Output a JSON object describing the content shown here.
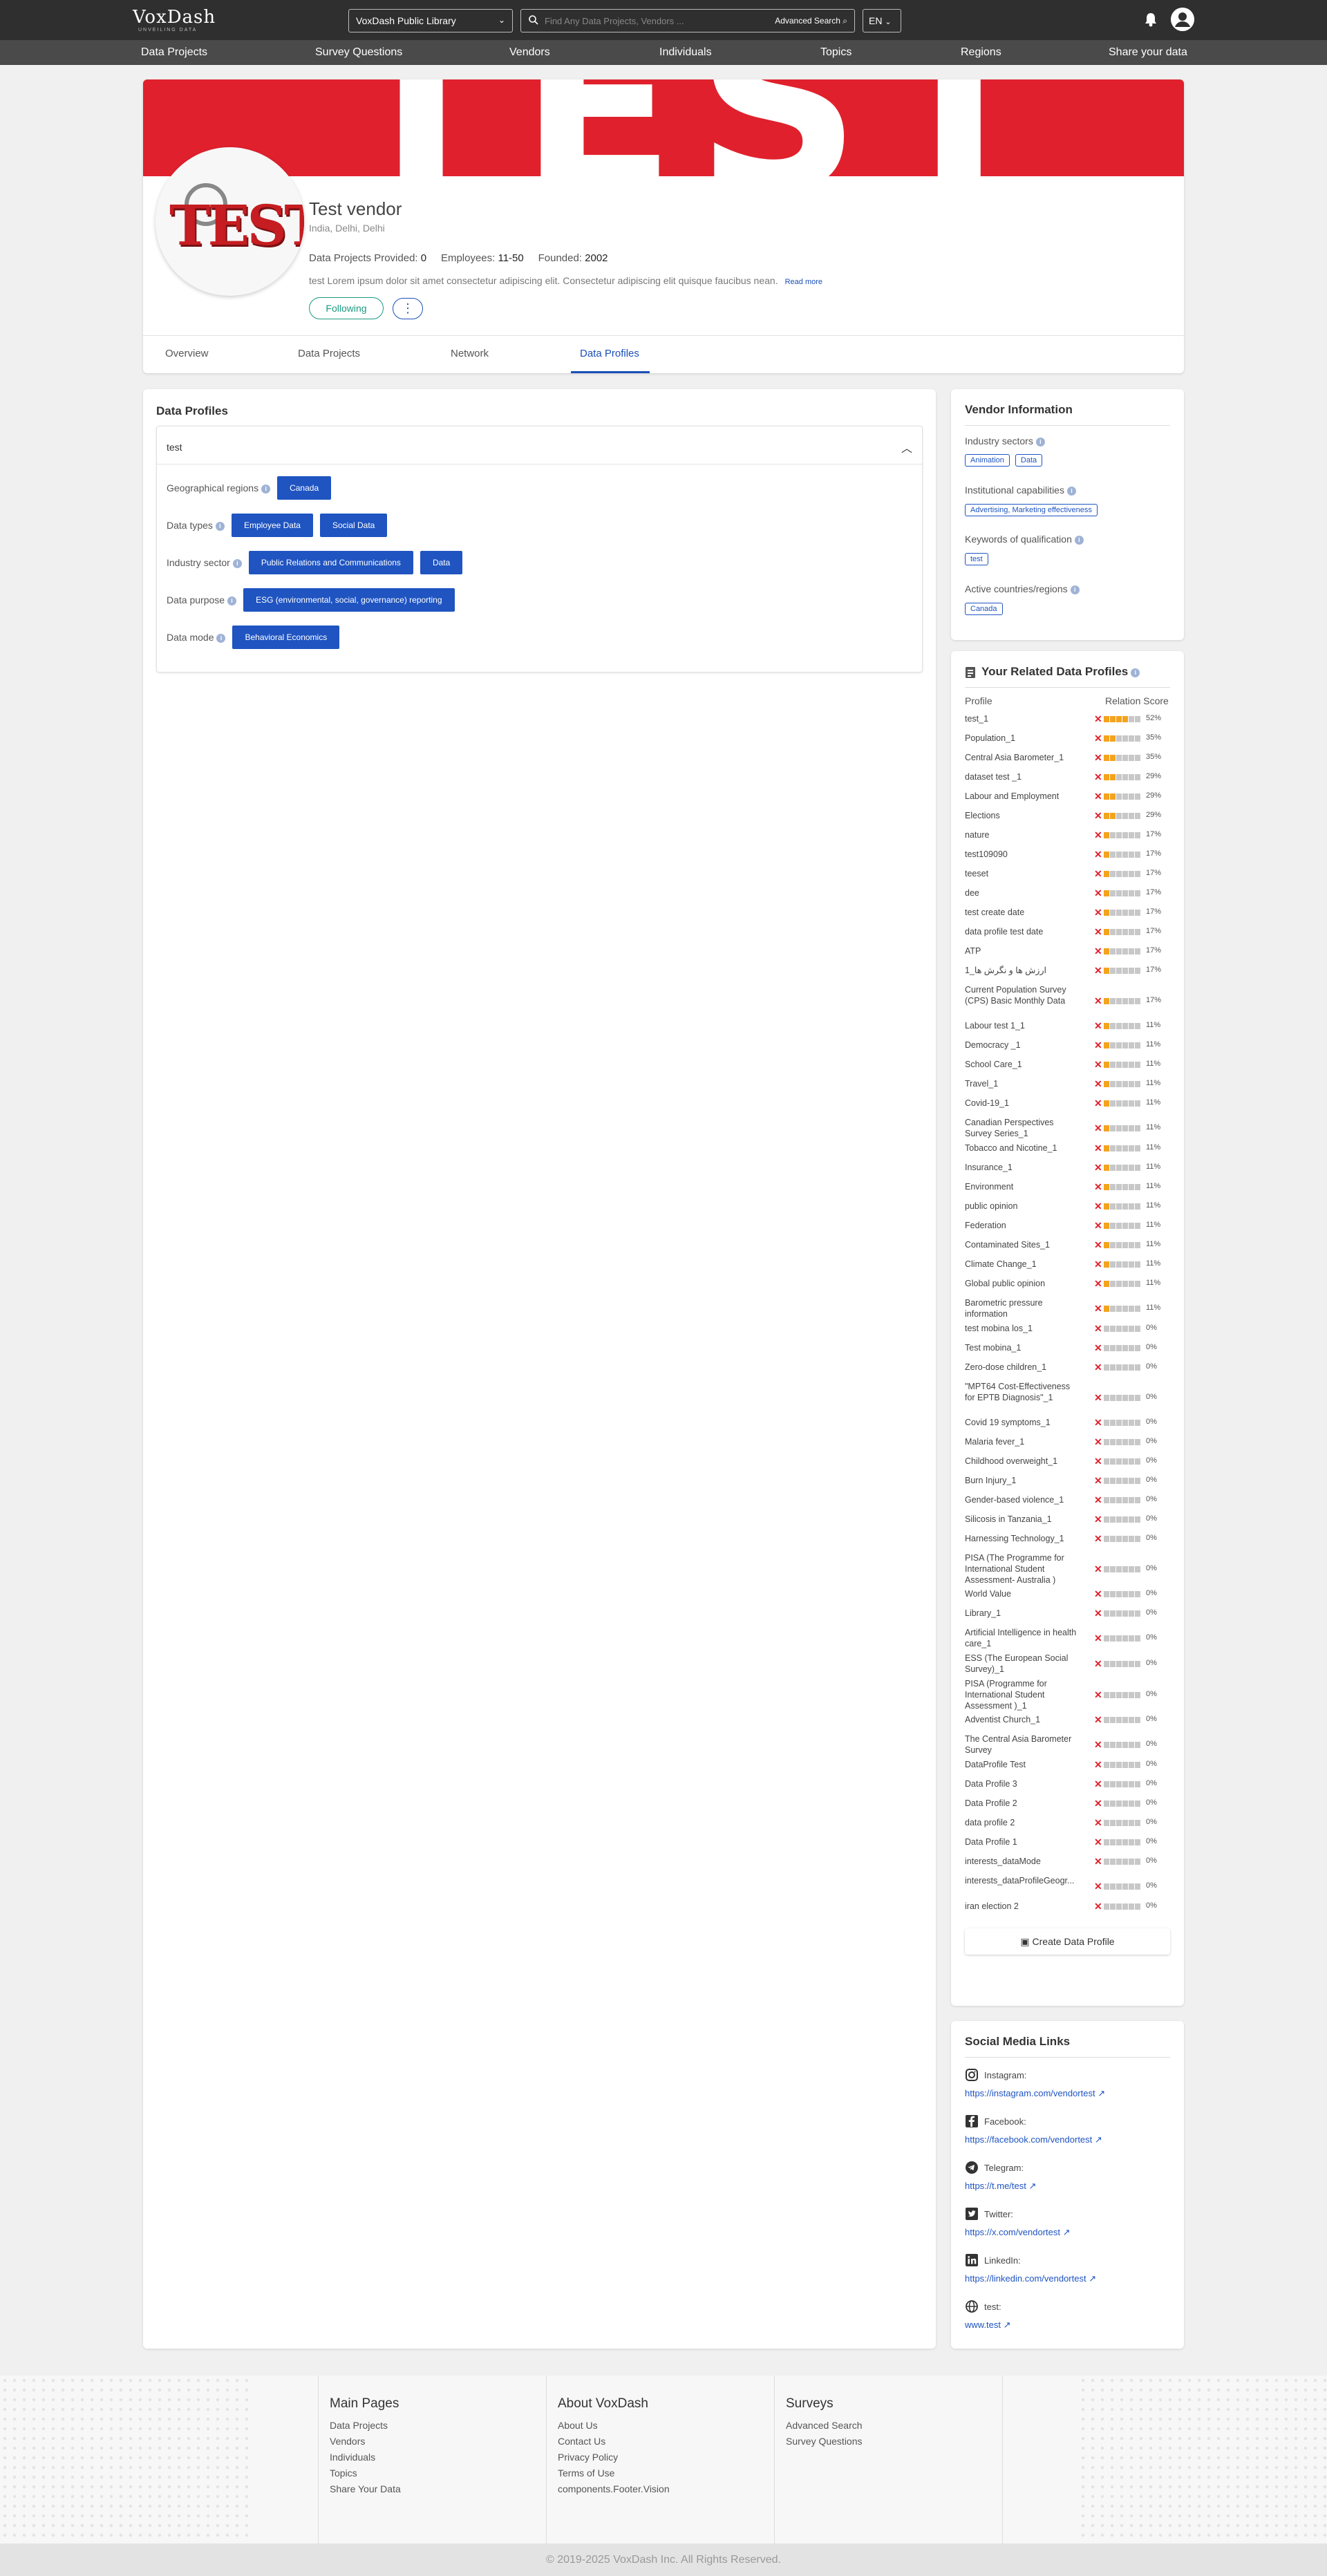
{
  "app": {
    "logo": "VoxDash",
    "logo_sub": "UNVEILING DATA"
  },
  "topbar": {
    "library": "VoxDash Public Library",
    "search_placeholder": "Find Any Data Projects, Vendors ...",
    "advanced_search": "Advanced Search",
    "lang": "EN"
  },
  "nav": [
    "Data Projects",
    "Survey Questions",
    "Vendors",
    "Individuals",
    "Topics",
    "Regions",
    "Share your data"
  ],
  "vendor": {
    "banner_text": "TEST",
    "logo_text": "TEST",
    "name": "Test vendor",
    "location": "India, Delhi, Delhi",
    "dp_label": "Data Projects Provided:",
    "dp_value": "0",
    "emp_label": "Employees:",
    "emp_value": "11-50",
    "founded_label": "Founded:",
    "founded_value": "2002",
    "description": "test Lorem ipsum dolor sit amet consectetur adipiscing elit. Consectetur adipiscing elit quisque faucibus nean.",
    "read_more": "Read more",
    "follow_label": "Following",
    "more_label": "⋮"
  },
  "tabs": [
    "Overview",
    "Data Projects",
    "Network",
    "Data Profiles"
  ],
  "data_profiles": {
    "heading": "Data Profiles",
    "profile_title": "test",
    "rows": [
      {
        "label": "Geographical regions",
        "chips": [
          "Canada"
        ]
      },
      {
        "label": "Data types",
        "chips": [
          "Employee Data",
          "Social Data"
        ]
      },
      {
        "label": "Industry sector",
        "chips": [
          "Public Relations and Communications",
          "Data"
        ]
      },
      {
        "label": "Data purpose",
        "chips": [
          "ESG (environmental, social, governance) reporting"
        ]
      },
      {
        "label": "Data mode",
        "chips": [
          "Behavioral Economics"
        ]
      }
    ]
  },
  "vendor_info": {
    "heading": "Vendor Information",
    "industry_label": "Industry sectors",
    "industry": [
      "Animation",
      "Data"
    ],
    "inst_label": "Institutional capabilities",
    "inst": [
      "Advertising, Marketing effectiveness"
    ],
    "kw_label": "Keywords of qualification",
    "kw": [
      "test"
    ],
    "active_label": "Active countries/regions",
    "active": [
      "Canada"
    ]
  },
  "related": {
    "heading": "Your Related Data Profiles",
    "col_profile": "Profile",
    "col_score": "Relation Score",
    "create_label": "Create Data Profile",
    "rows": [
      {
        "name": "test_1",
        "pct": "52%",
        "level": 0.52
      },
      {
        "name": "Population_1",
        "pct": "35%",
        "level": 0.35
      },
      {
        "name": "Central Asia Barometer_1",
        "pct": "35%",
        "level": 0.35
      },
      {
        "name": "dataset test _1",
        "pct": "29%",
        "level": 0.29
      },
      {
        "name": "Labour and Employment",
        "pct": "29%",
        "level": 0.29
      },
      {
        "name": "Elections",
        "pct": "29%",
        "level": 0.29
      },
      {
        "name": "nature",
        "pct": "17%",
        "level": 0.17
      },
      {
        "name": "test109090",
        "pct": "17%",
        "level": 0.17
      },
      {
        "name": "teeset",
        "pct": "17%",
        "level": 0.17
      },
      {
        "name": "dee",
        "pct": "17%",
        "level": 0.17
      },
      {
        "name": "test create date",
        "pct": "17%",
        "level": 0.17
      },
      {
        "name": "data profile test date",
        "pct": "17%",
        "level": 0.17
      },
      {
        "name": "ATP",
        "pct": "17%",
        "level": 0.17
      },
      {
        "name": "ارزش ها و نگرش ها_1",
        "pct": "17%",
        "level": 0.17
      },
      {
        "name": "Current Population Survey (CPS) Basic Monthly Data",
        "pct": "17%",
        "level": 0.17
      },
      {
        "name": "Labour test 1_1",
        "pct": "11%",
        "level": 0.11
      },
      {
        "name": "Democracy _1",
        "pct": "11%",
        "level": 0.11
      },
      {
        "name": "School Care_1",
        "pct": "11%",
        "level": 0.11
      },
      {
        "name": "Travel_1",
        "pct": "11%",
        "level": 0.11
      },
      {
        "name": "Covid-19_1",
        "pct": "11%",
        "level": 0.11
      },
      {
        "name": "Canadian Perspectives Survey Series_1",
        "pct": "11%",
        "level": 0.11
      },
      {
        "name": "Tobacco and Nicotine_1",
        "pct": "11%",
        "level": 0.11
      },
      {
        "name": "Insurance_1",
        "pct": "11%",
        "level": 0.11
      },
      {
        "name": "Environment",
        "pct": "11%",
        "level": 0.11
      },
      {
        "name": "public opinion",
        "pct": "11%",
        "level": 0.11
      },
      {
        "name": "Federation",
        "pct": "11%",
        "level": 0.11
      },
      {
        "name": "Contaminated Sites_1",
        "pct": "11%",
        "level": 0.11
      },
      {
        "name": "Climate Change_1",
        "pct": "11%",
        "level": 0.11
      },
      {
        "name": "Global public opinion",
        "pct": "11%",
        "level": 0.11
      },
      {
        "name": "Barometric pressure information",
        "pct": "11%",
        "level": 0.11
      },
      {
        "name": "test mobina los_1",
        "pct": "0%",
        "level": 0
      },
      {
        "name": "Test mobina_1",
        "pct": "0%",
        "level": 0
      },
      {
        "name": "Zero-dose children_1",
        "pct": "0%",
        "level": 0
      },
      {
        "name": "\"MPT64 Cost-Effectiveness for EPTB Diagnosis\"_1",
        "pct": "0%",
        "level": 0
      },
      {
        "name": "Covid 19 symptoms_1",
        "pct": "0%",
        "level": 0
      },
      {
        "name": "Malaria fever_1",
        "pct": "0%",
        "level": 0
      },
      {
        "name": "Childhood overweight_1",
        "pct": "0%",
        "level": 0
      },
      {
        "name": "Burn Injury_1",
        "pct": "0%",
        "level": 0
      },
      {
        "name": "Gender-based violence_1",
        "pct": "0%",
        "level": 0
      },
      {
        "name": "Silicosis in Tanzania_1",
        "pct": "0%",
        "level": 0
      },
      {
        "name": "Harnessing Technology_1",
        "pct": "0%",
        "level": 0
      },
      {
        "name": "PISA (The Programme for International Student Assessment- Australia )",
        "pct": "0%",
        "level": 0
      },
      {
        "name": "World Value",
        "pct": "0%",
        "level": 0
      },
      {
        "name": "Library_1",
        "pct": "0%",
        "level": 0
      },
      {
        "name": "Artificial Intelligence in health care_1",
        "pct": "0%",
        "level": 0
      },
      {
        "name": "ESS (The European Social Survey)_1",
        "pct": "0%",
        "level": 0
      },
      {
        "name": "PISA (Programme for International Student Assessment )_1",
        "pct": "0%",
        "level": 0
      },
      {
        "name": "Adventist Church_1",
        "pct": "0%",
        "level": 0
      },
      {
        "name": "The Central Asia Barometer Survey",
        "pct": "0%",
        "level": 0
      },
      {
        "name": "DataProfile Test",
        "pct": "0%",
        "level": 0
      },
      {
        "name": "Data Profile 3",
        "pct": "0%",
        "level": 0
      },
      {
        "name": "Data Profile 2",
        "pct": "0%",
        "level": 0
      },
      {
        "name": "data profile 2",
        "pct": "0%",
        "level": 0
      },
      {
        "name": "Data Profile 1",
        "pct": "0%",
        "level": 0
      },
      {
        "name": "interests_dataMode",
        "pct": "0%",
        "level": 0
      },
      {
        "name": "interests_dataProfileGeogr...",
        "pct": "0%",
        "level": 0
      },
      {
        "name": "iran election 2",
        "pct": "0%",
        "level": 0
      }
    ]
  },
  "social": {
    "heading": "Social Media Links",
    "items": [
      {
        "label": "Instagram:",
        "url": "https://instagram.com/vendortest",
        "icon": "instagram-icon"
      },
      {
        "label": "Facebook:",
        "url": "https://facebook.com/vendortest",
        "icon": "facebook-icon"
      },
      {
        "label": "Telegram:",
        "url": "https://t.me/test",
        "icon": "telegram-icon"
      },
      {
        "label": "Twitter:",
        "url": "https://x.com/vendortest",
        "icon": "twitter-icon"
      },
      {
        "label": "LinkedIn:",
        "url": "https://linkedin.com/vendortest",
        "icon": "linkedin-icon"
      },
      {
        "label": "test:",
        "url": "www.test",
        "icon": "globe-icon"
      }
    ]
  },
  "footer": {
    "cols": [
      {
        "title": "Main Pages",
        "links": [
          "Data Projects",
          "Vendors",
          "Individuals",
          "Topics",
          "Share Your Data"
        ]
      },
      {
        "title": "About VoxDash",
        "links": [
          "About Us",
          "Contact Us",
          "Privacy Policy",
          "Terms of Use",
          "components.Footer.Vision"
        ]
      },
      {
        "title": "Surveys",
        "links": [
          "Advanced Search",
          "Survey Questions"
        ]
      }
    ],
    "copyright": "© 2019-2025 VoxDash Inc. All Rights Reserved."
  },
  "colors": {
    "accent": "#1f54c1",
    "brand_red": "#e0212d",
    "score_bar": "#f4a31d",
    "follow": "#1a9a82"
  }
}
